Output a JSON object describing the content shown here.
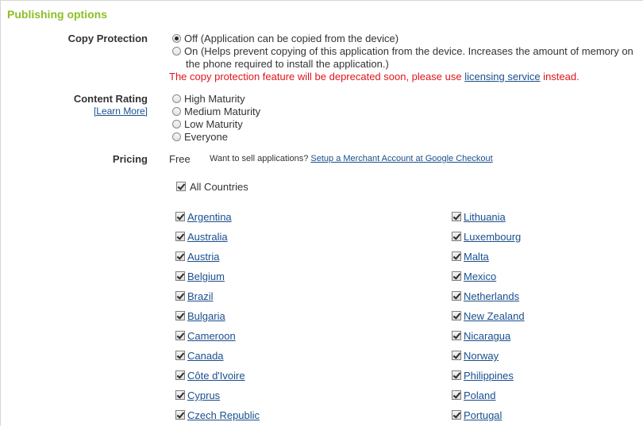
{
  "section_title": "Publishing options",
  "copy_protection": {
    "label": "Copy Protection",
    "off_label": "Off (Application can be copied from the device)",
    "on_label_line1": "On (Helps prevent copying of this application from the device. Increases the amount of memory on",
    "on_label_line2": "the phone required to install the application.)",
    "selected": "off",
    "warning_prefix": "The copy protection feature will be deprecated soon, please use ",
    "warning_link": "licensing service",
    "warning_suffix": " instead."
  },
  "content_rating": {
    "label": "Content Rating",
    "learn_more": "[Learn More]",
    "options": [
      "High Maturity",
      "Medium Maturity",
      "Low Maturity",
      "Everyone"
    ]
  },
  "pricing": {
    "label": "Pricing",
    "value": "Free",
    "sell_prompt": "Want to sell applications?",
    "sell_link": "Setup a Merchant Account at Google Checkout"
  },
  "all_countries": {
    "label": "All Countries",
    "checked": true
  },
  "countries_left": [
    "Argentina",
    "Australia",
    "Austria",
    "Belgium",
    "Brazil",
    "Bulgaria",
    "Cameroon",
    "Canada",
    "Côte d'Ivoire",
    "Cyprus",
    "Czech Republic"
  ],
  "countries_right": [
    "Lithuania",
    "Luxembourg",
    "Malta",
    "Mexico",
    "Netherlands",
    "New Zealand",
    "Nicaragua",
    "Norway",
    "Philippines",
    "Poland",
    "Portugal"
  ]
}
